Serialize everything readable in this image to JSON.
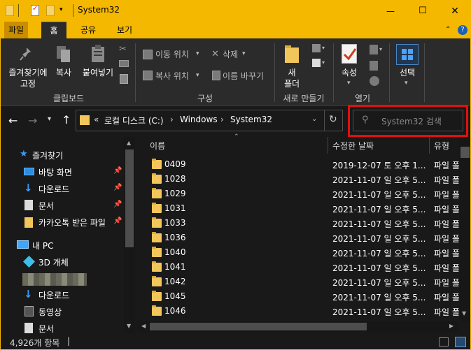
{
  "window": {
    "title": "System32",
    "controls": {
      "minimize": "—",
      "maximize": "☐",
      "close": "✕"
    }
  },
  "tabs": [
    {
      "label": "파일"
    },
    {
      "label": "홈"
    },
    {
      "label": "공유"
    },
    {
      "label": "보기"
    }
  ],
  "ribbon": {
    "pin_label_1": "즐겨찾기에",
    "pin_label_2": "고정",
    "copy_label": "복사",
    "paste_label": "붙여넣기",
    "group_clipboard": "클립보드",
    "move_label": "이동 위치",
    "copyto_label": "복사 위치",
    "delete_label": "삭제",
    "rename_label": "이름 바꾸기",
    "group_organize": "구성",
    "newfolder_label_1": "새",
    "newfolder_label_2": "폴더",
    "group_new": "새로 만들기",
    "props_label": "속성",
    "group_open": "열기",
    "select_label": "선택"
  },
  "address": {
    "chev": "«",
    "crumbs": [
      "로컬 디스크 (C:)",
      "Windows",
      "System32"
    ],
    "sep": "›"
  },
  "search": {
    "placeholder": "System32 검색"
  },
  "nav": {
    "quick_access": "즐겨찾기",
    "items": [
      {
        "label": "바탕 화면"
      },
      {
        "label": "다운로드"
      },
      {
        "label": "문서"
      },
      {
        "label": "카카오톡 받은 파일"
      }
    ],
    "this_pc": "내 PC",
    "pc_items": [
      {
        "label": "3D 개체"
      },
      {
        "label": "다운로드"
      },
      {
        "label": "동영상"
      },
      {
        "label": "문서"
      }
    ]
  },
  "columns": {
    "name": "이름",
    "date": "수정한 날짜",
    "type": "유형"
  },
  "rows": [
    {
      "name": "0409",
      "date": "2019-12-07 토 오후 1...",
      "type": "파일 폴"
    },
    {
      "name": "1028",
      "date": "2021-11-07 일 오후 5...",
      "type": "파일 폴"
    },
    {
      "name": "1029",
      "date": "2021-11-07 일 오후 5...",
      "type": "파일 폴"
    },
    {
      "name": "1031",
      "date": "2021-11-07 일 오후 5...",
      "type": "파일 폴"
    },
    {
      "name": "1033",
      "date": "2021-11-07 일 오후 5...",
      "type": "파일 폴"
    },
    {
      "name": "1036",
      "date": "2021-11-07 일 오후 5...",
      "type": "파일 폴"
    },
    {
      "name": "1040",
      "date": "2021-11-07 일 오후 5...",
      "type": "파일 폴"
    },
    {
      "name": "1041",
      "date": "2021-11-07 일 오후 5...",
      "type": "파일 폴"
    },
    {
      "name": "1042",
      "date": "2021-11-07 일 오후 5...",
      "type": "파일 폴"
    },
    {
      "name": "1045",
      "date": "2021-11-07 일 오후 5...",
      "type": "파일 폴"
    },
    {
      "name": "1046",
      "date": "2021-11-07 일 오후 5...",
      "type": "파일 폴"
    }
  ],
  "status": {
    "count": "4,926개 항목",
    "cursor": "|"
  },
  "colors": {
    "accent": "#f5b800",
    "highlight": "#e01010",
    "folder": "#f2c65a"
  }
}
